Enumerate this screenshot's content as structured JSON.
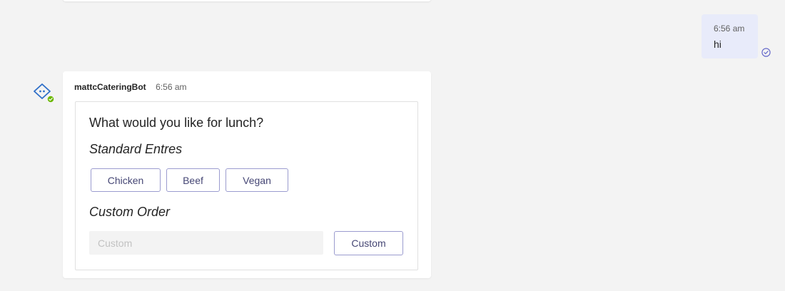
{
  "previous_message": {},
  "user_message": {
    "time": "6:56 am",
    "text": "hi",
    "status_icon": "read-check-icon"
  },
  "bot_message": {
    "avatar_icon": "bot-avatar-icon",
    "sender": "mattcCateringBot",
    "time": "6:56 am",
    "card": {
      "title": "What would you like for lunch?",
      "standard_heading": "Standard Entres",
      "options": [
        "Chicken",
        "Beef",
        "Vegan"
      ],
      "custom_heading": "Custom Order",
      "custom_input": {
        "value": "",
        "placeholder": "Custom"
      },
      "custom_button": "Custom"
    }
  },
  "colors": {
    "background": "#f3f3f3",
    "user_bubble": "#e8ebfa",
    "button_text": "#464775",
    "button_border": "#9b9ccf",
    "bot_icon": "#2f6fc8",
    "online_badge": "#6bb700"
  }
}
